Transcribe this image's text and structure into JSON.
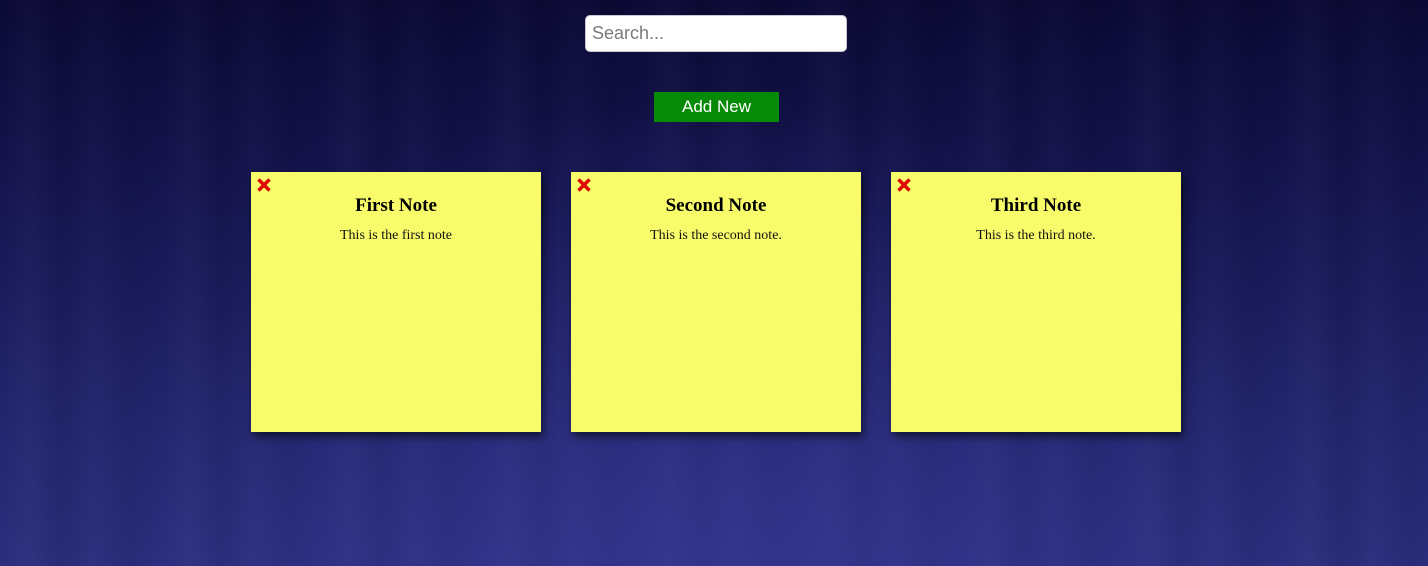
{
  "search": {
    "placeholder": "Search...",
    "value": ""
  },
  "toolbar": {
    "add_label": "Add New",
    "add_color": "#078a07"
  },
  "notes": [
    {
      "title": "First Note",
      "body": "This is the first note",
      "delete_icon": "close-x-icon"
    },
    {
      "title": "Second Note",
      "body": "This is the second note.",
      "delete_icon": "close-x-icon"
    },
    {
      "title": "Third Note",
      "body": "This is the third note.",
      "delete_icon": "close-x-icon"
    }
  ],
  "colors": {
    "note_background": "#f9fc6a",
    "delete_icon": "#e00000",
    "page_background": "#161653"
  }
}
